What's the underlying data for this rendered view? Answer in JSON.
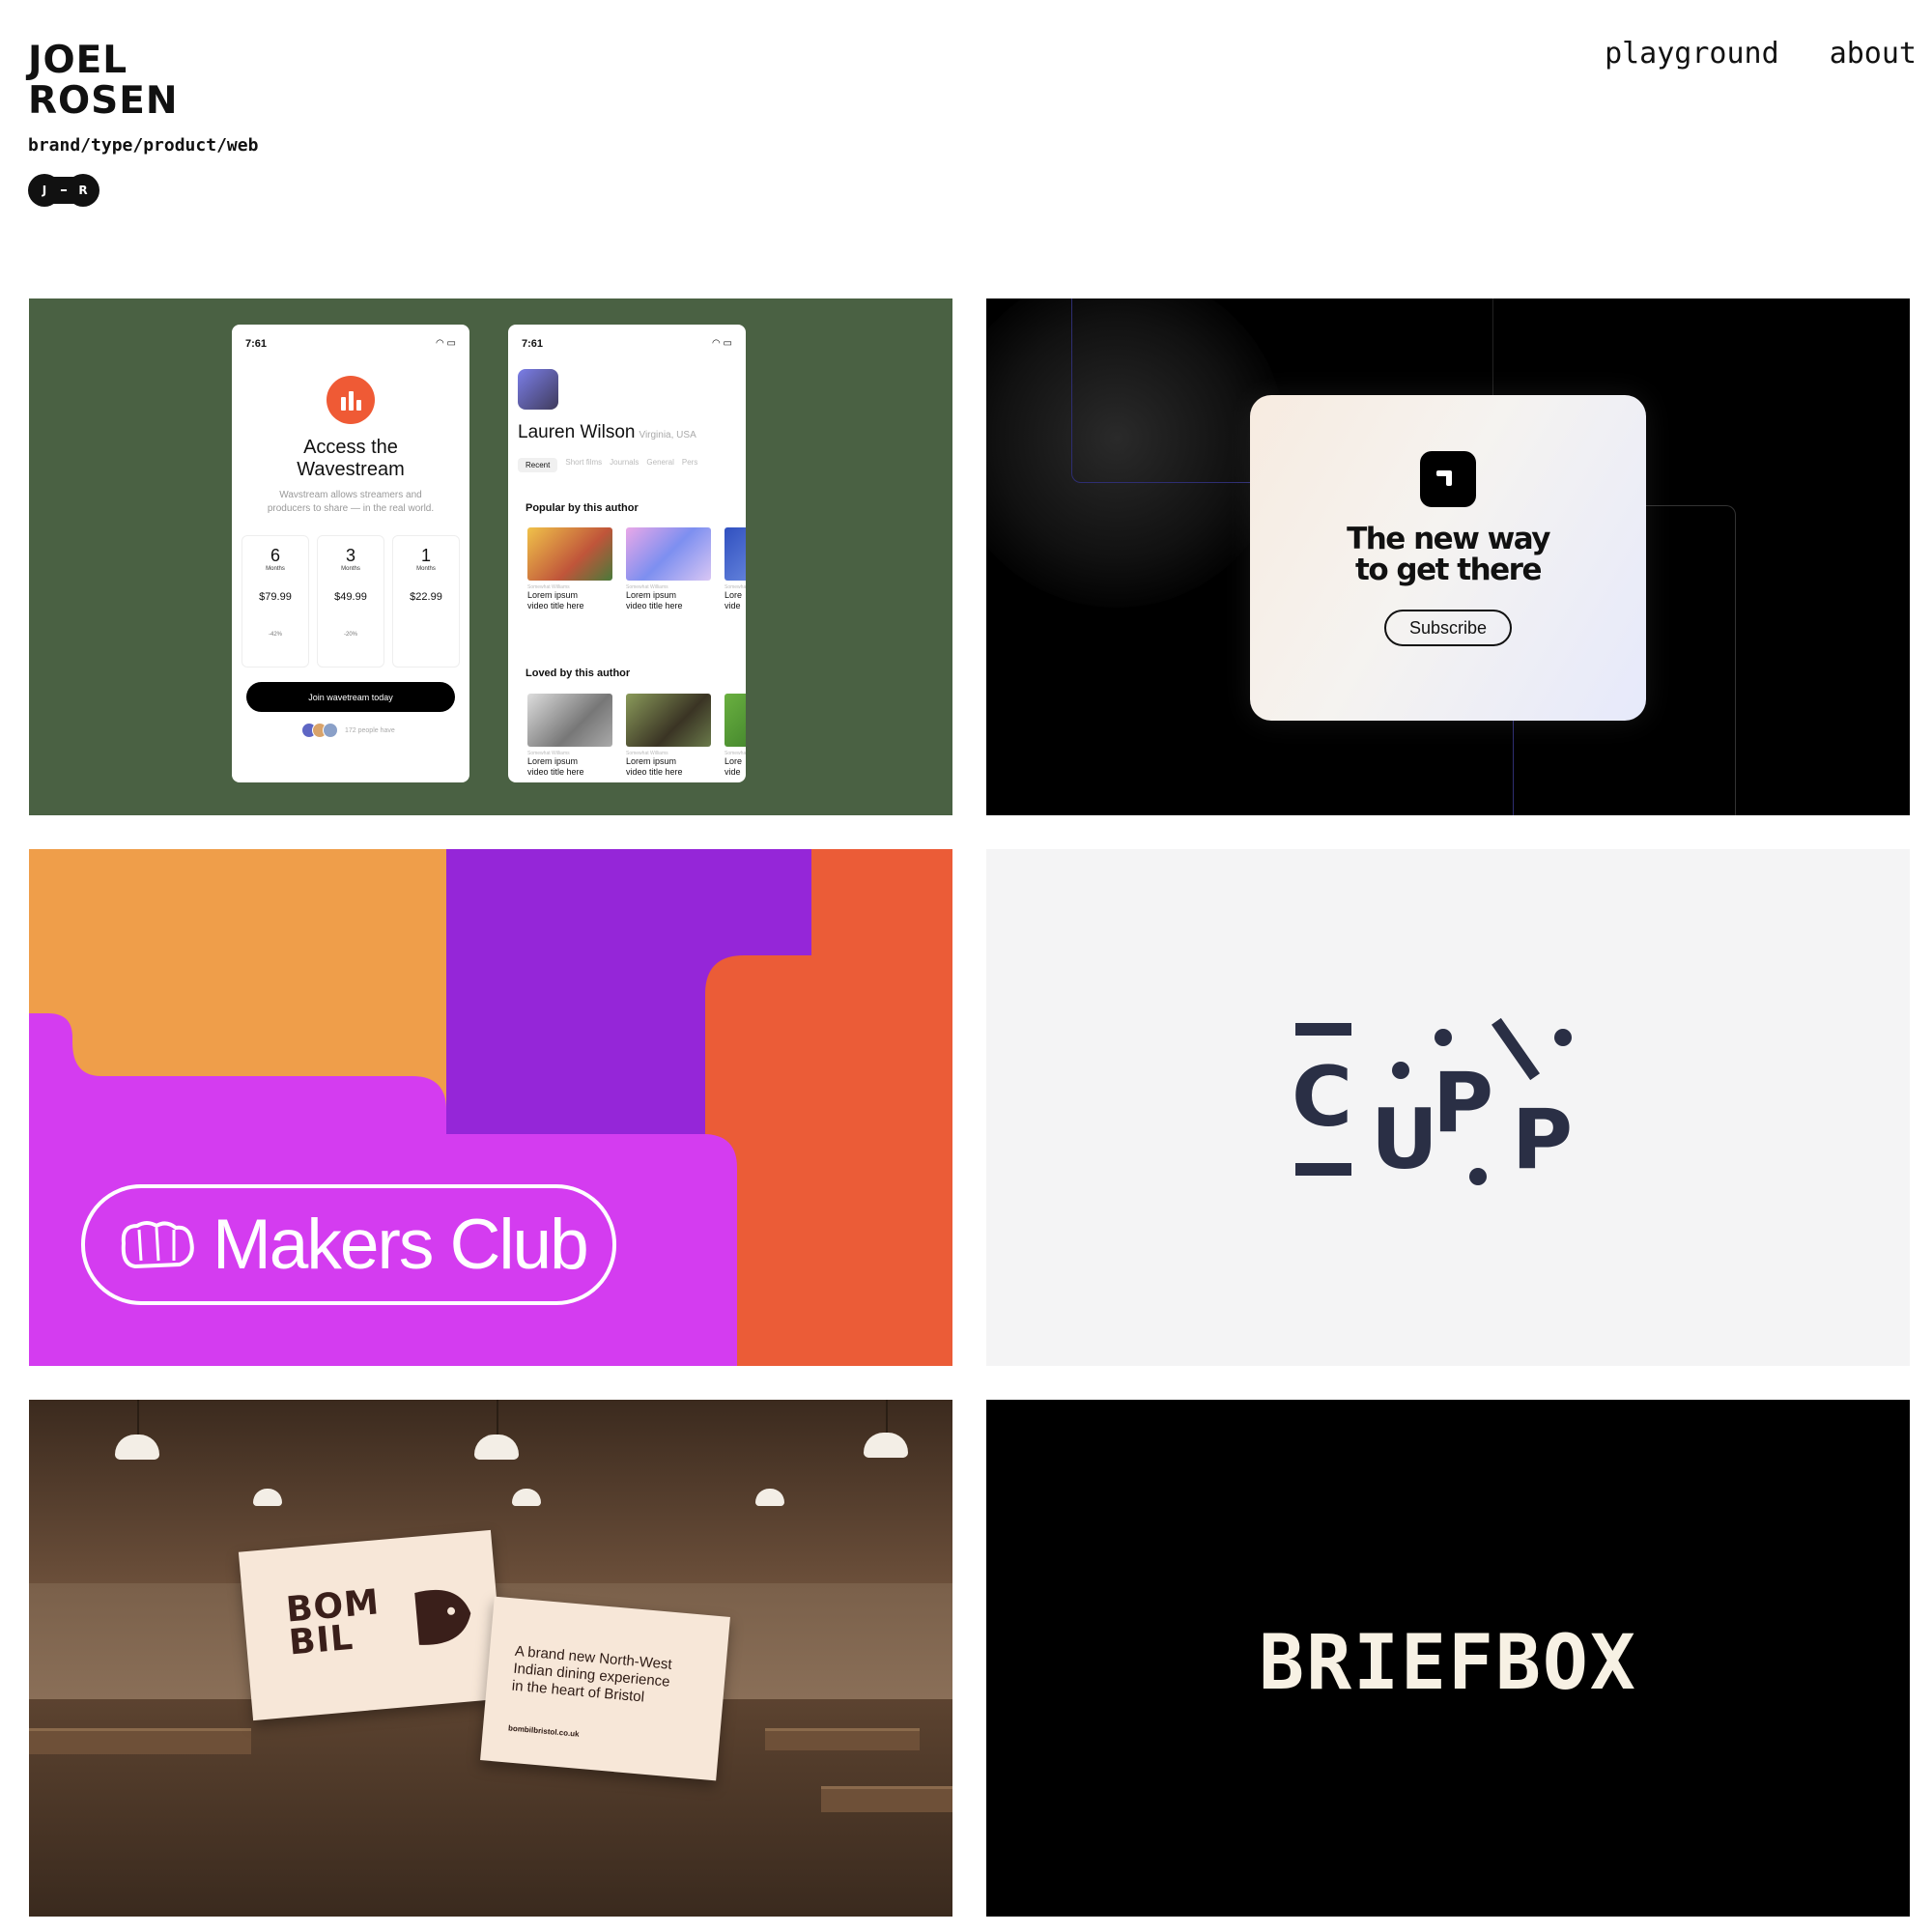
{
  "header": {
    "name_line1": "JOEL",
    "name_line2": "ROSEN",
    "tagline": "brand/type/product/web",
    "monogram": {
      "left": "J",
      "right": "R"
    }
  },
  "nav": {
    "items": [
      "playground",
      "about"
    ]
  },
  "projects": {
    "wavestream": {
      "phone1": {
        "time": "7:61",
        "title_line1": "Access the",
        "title_line2": "Wavestream",
        "description": "Wavstream allows streamers and producers to share — in the real world.",
        "plans": [
          {
            "months": "6",
            "unit": "Months",
            "price": "$79.99",
            "discount": "-42%"
          },
          {
            "months": "3",
            "unit": "Months",
            "price": "$49.99",
            "discount": "-20%"
          },
          {
            "months": "1",
            "unit": "Months",
            "price": "$22.99",
            "discount": ""
          }
        ],
        "cta": "Join wavetream today",
        "people_text": "172 people have"
      },
      "phone2": {
        "time": "7:61",
        "name": "Lauren Wilson",
        "location": "Virginia, USA",
        "tabs": [
          "Recent",
          "Short films",
          "Journals",
          "General",
          "Pers"
        ],
        "section1": "Popular by this author",
        "section2": "Loved by this author",
        "card_meta": "Somewhat Williams",
        "card_title_line1": "Lorem ipsum",
        "card_title_line2": "video title here",
        "card_partial_line1": "Lore",
        "card_partial_line2": "vide"
      }
    },
    "subscribe": {
      "headline_line1": "The new way",
      "headline_line2": "to get there",
      "button": "Subscribe"
    },
    "makers_club": {
      "label": "Makers Club"
    },
    "cupp": {
      "letters": [
        "C",
        "U",
        "P",
        "P"
      ]
    },
    "bombil": {
      "logo_line1": "BOM",
      "logo_line2": "BIL",
      "tagline_line1": "A brand new North-West",
      "tagline_line2": "Indian dining experience",
      "tagline_line3": "in the heart of Bristol",
      "url": "bombilbristol.co.uk"
    },
    "briefbox": {
      "wordmark": "BRIEFBOX"
    }
  },
  "colors": {
    "wavestream_bg": "#4a6143",
    "makers_orange": "#ef9e4a",
    "makers_purple": "#9526d8",
    "makers_magenta": "#d43cf0",
    "makers_red": "#eb5c37",
    "cupp_ink": "#2a2f45",
    "briefbox_ink": "#f7f1e4"
  }
}
